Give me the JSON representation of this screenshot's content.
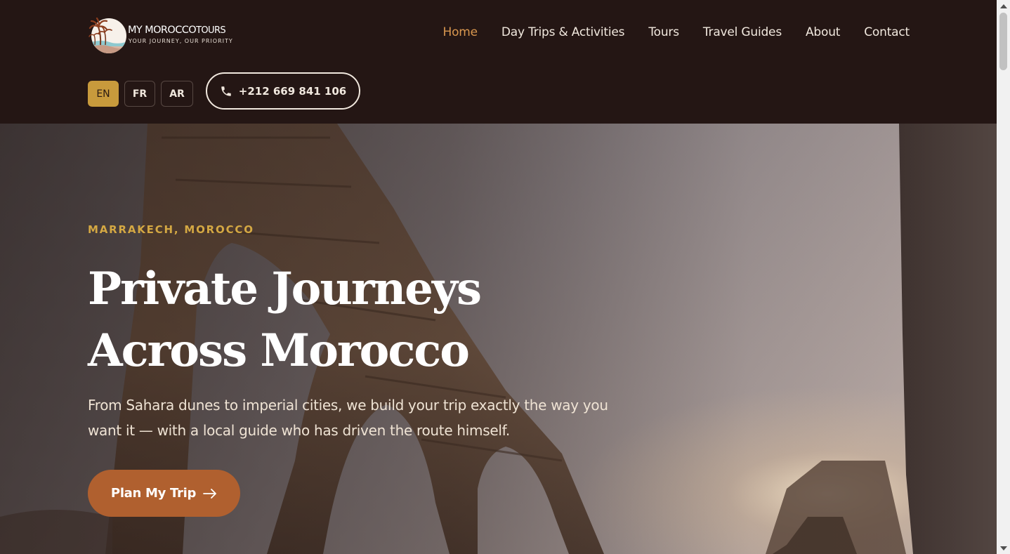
{
  "brand": {
    "name_bold": "MY MOROCCO",
    "name_light": "TOURS",
    "tagline": "YOUR JOURNEY, OUR PRIORITY",
    "logo_icon": "palm-beach-logo-icon"
  },
  "nav": {
    "items": [
      {
        "label": "Home",
        "active": true
      },
      {
        "label": "Day Trips & Activities",
        "active": false
      },
      {
        "label": "Tours",
        "active": false
      },
      {
        "label": "Travel Guides",
        "active": false
      },
      {
        "label": "About",
        "active": false
      },
      {
        "label": "Contact",
        "active": false
      }
    ]
  },
  "languages": {
    "items": [
      "EN",
      "FR",
      "AR"
    ],
    "selected": "EN"
  },
  "phone": {
    "icon": "phone-icon",
    "number": "+212 669 841 106"
  },
  "hero": {
    "eyebrow": "MARRAKECH, MOROCCO",
    "title": "Private Journeys Across Morocco",
    "subtitle": "From Sahara dunes to imperial cities, we build your trip exactly the way you want it — with a local guide who has driven the route himself.",
    "cta_label": "Plan My Trip",
    "cta_icon": "arrow-right-icon"
  },
  "colors": {
    "header_bg": "#241614",
    "nav_active": "#d9974f",
    "eyebrow": "#d4a843",
    "lang_active_bg": "#c89a3c",
    "cta_bg": "#b0602f"
  }
}
